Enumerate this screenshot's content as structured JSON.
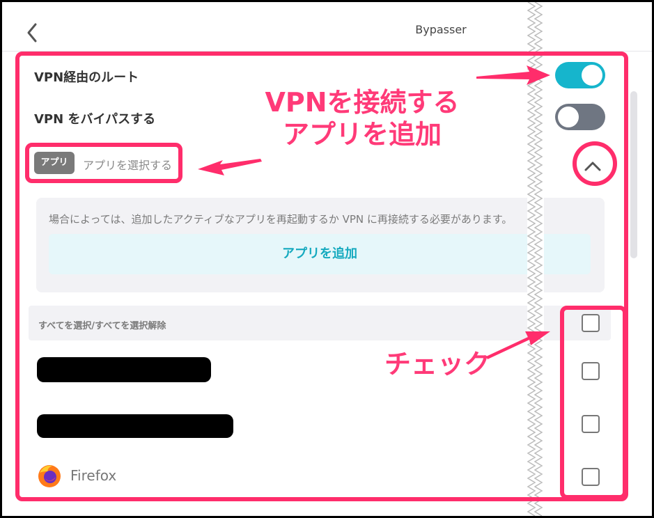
{
  "header": {
    "title": "Bypasser"
  },
  "settings": {
    "vpn_route_label": "VPN経由のルート",
    "vpn_route_on": true,
    "bypass_label": "VPN をバイパスする",
    "bypass_on": false
  },
  "app_selector": {
    "chip_label": "アプリ",
    "placeholder": "アプリを選択する"
  },
  "info": {
    "message": "場合によっては、追加したアクティブなアプリを再起動するか VPN に再接続する必要があります。",
    "add_button_label": "アプリを追加"
  },
  "list": {
    "select_all_label": "すべてを選択/すべてを選択解除",
    "apps": [
      {
        "name": "",
        "redacted": true,
        "checked": false
      },
      {
        "name": "",
        "redacted": true,
        "checked": false
      },
      {
        "name": "Firefox",
        "redacted": false,
        "checked": false
      }
    ]
  },
  "annotations": {
    "connect_note_line1": "VPNを接続する",
    "connect_note_line2": "アプリを追加",
    "check_note": "チェック"
  },
  "colors": {
    "accent": "#16b5cc",
    "annotation": "#ff2d6b",
    "toggle_off": "#6f7682"
  }
}
